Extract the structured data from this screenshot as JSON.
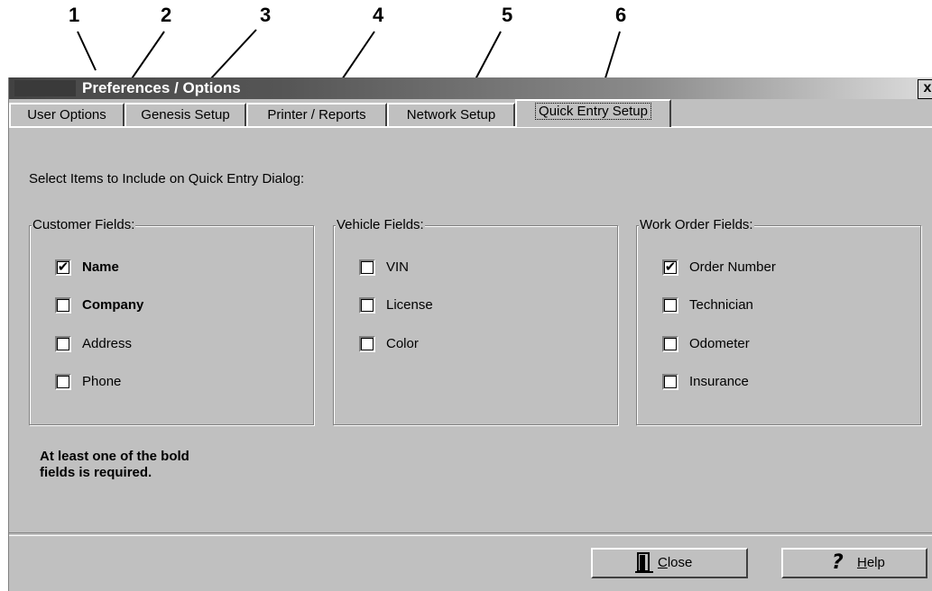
{
  "callouts": [
    "1",
    "2",
    "3",
    "4",
    "5",
    "6"
  ],
  "window": {
    "title": "Preferences / Options",
    "close_glyph": "x"
  },
  "tabs": [
    {
      "label": "User Options",
      "active": false
    },
    {
      "label": "Genesis Setup",
      "active": false
    },
    {
      "label": "Printer / Reports",
      "active": false
    },
    {
      "label": "Network Setup",
      "active": false
    },
    {
      "label": "Quick Entry Setup",
      "active": true
    }
  ],
  "instruction": "Select Items to Include on Quick Entry Dialog:",
  "groups": {
    "customer": {
      "label": "Customer Fields:",
      "items": [
        {
          "label": "Name",
          "checked": true,
          "bold": true
        },
        {
          "label": "Company",
          "checked": false,
          "bold": true
        },
        {
          "label": "Address",
          "checked": false,
          "bold": false
        },
        {
          "label": "Phone",
          "checked": false,
          "bold": false
        }
      ]
    },
    "vehicle": {
      "label": "Vehicle Fields:",
      "items": [
        {
          "label": "VIN",
          "checked": false,
          "bold": false
        },
        {
          "label": "License",
          "checked": false,
          "bold": false
        },
        {
          "label": "Color",
          "checked": false,
          "bold": false
        }
      ]
    },
    "workorder": {
      "label": "Work Order Fields:",
      "items": [
        {
          "label": "Order Number",
          "checked": true,
          "bold": false
        },
        {
          "label": "Technician",
          "checked": false,
          "bold": false
        },
        {
          "label": "Odometer",
          "checked": false,
          "bold": false
        },
        {
          "label": "Insurance",
          "checked": false,
          "bold": false
        }
      ]
    }
  },
  "note": {
    "line1": "At least one of the bold",
    "line2": "fields is required."
  },
  "buttons": {
    "close": {
      "mnemonic": "C",
      "rest": "lose",
      "icon": "door-icon"
    },
    "help": {
      "mnemonic": "H",
      "rest": "elp",
      "icon": "question-icon",
      "glyph": "?"
    }
  },
  "check_glyph": "✔"
}
